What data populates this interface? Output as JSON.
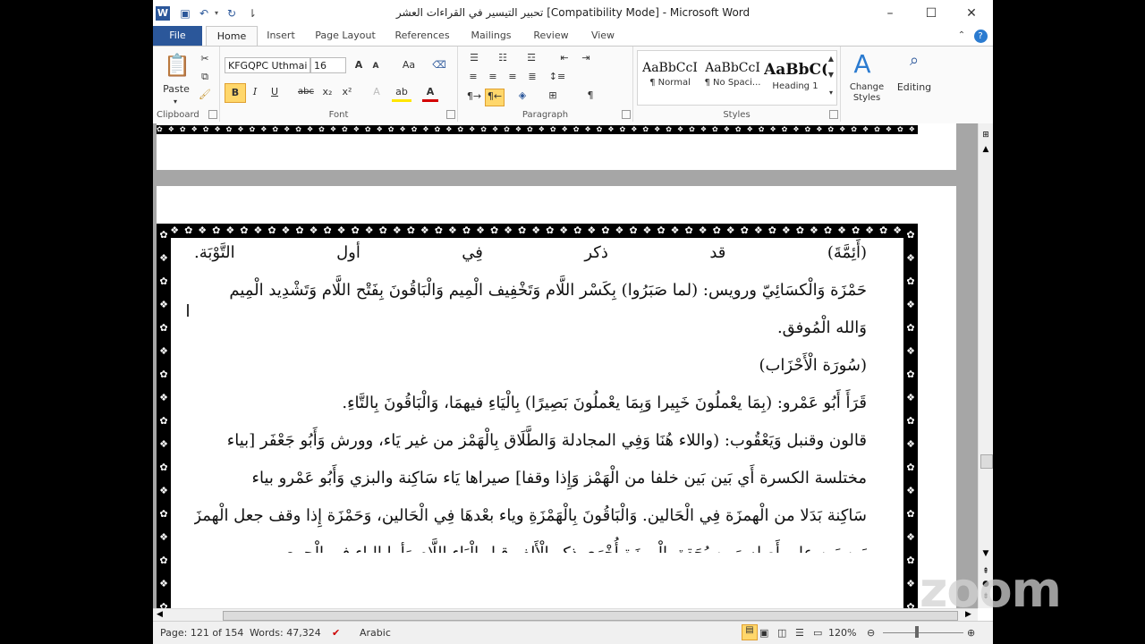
{
  "window": {
    "title": "تحبير التيسير في القراءات العشر [Compatibility Mode]  -  Microsoft Word",
    "minimize": "–",
    "maximize": "☐",
    "close": "✕"
  },
  "tabs": [
    {
      "label": "File"
    },
    {
      "label": "Home"
    },
    {
      "label": "Insert"
    },
    {
      "label": "Page Layout"
    },
    {
      "label": "References"
    },
    {
      "label": "Mailings"
    },
    {
      "label": "Review"
    },
    {
      "label": "View"
    }
  ],
  "ribbon": {
    "clipboard": {
      "paste": "Paste",
      "label": "Clipboard"
    },
    "font": {
      "name": "KFGQPC Uthmai",
      "size": "16",
      "label": "Font",
      "bold": "B",
      "italic": "I",
      "underline": "U",
      "strike": "abc",
      "subscript": "x₂",
      "superscript": "x²",
      "grow": "A",
      "shrink": "A",
      "case": "Aa"
    },
    "paragraph": {
      "label": "Paragraph"
    },
    "styles": {
      "label": "Styles",
      "items": [
        {
          "sample": "AaBbCcI",
          "name": "¶ Normal"
        },
        {
          "sample": "AaBbCcI",
          "name": "¶ No Spaci..."
        },
        {
          "sample": "AaBbC(",
          "name": "Heading 1"
        }
      ],
      "change_styles": "Change Styles"
    },
    "editing": {
      "label": "Editing"
    }
  },
  "document": {
    "lines": [
      "(أَئِمَّةَ)     قد      ذكر      فِي      أول      التَّوْبَة.",
      "حَمْزَة وَالْكسَائِيّ ورويس: (لما صَبَرُوا) بِكَسْر اللَّام وَتَخْفِيف الْمِيم وَالْبَاقُونَ بِفَتْح اللَّام وَتَشْدِيد الْمِيم",
      "وَالله الْمُوفق.",
      "(سُورَة الْأَحْزَاب)",
      "قَرَأَ أَبُو عَمْرو: (بِمَا يعْملُونَ خَبِيرا وَبِمَا يعْملُونَ بَصِيرًا) بِالْيَاءِ فيهمَا، وَالْبَاقُونَ بِالتَّاءِ.",
      "قالون وقنبل وَيَعْقُوب: (واللاء هُنَا وَفِي المجادلة وَالطَّلَاق بِالْهَمْز من غير يَاء، وورش وَأَبُو جَعْفَر [بياء",
      "مختلسة الكسرة أَي بَين بَين خلفا من الْهَمْز وَإِذا وقفا] صيراها يَاء سَاكِنة والبزي وَأَبُو عَمْرو بياء",
      "سَاكِنة بَدَلا من الْهمزَة فِي الْحَالين. وَالْبَاقُونَ بِالْهَمْزَةِ وياء بعْدهَا فِي الْحَالين، وَحَمْزَة إِذا وقف جعل الْهمزَة",
      "بَين بَين على أَصله وَمن يُحَقق الْهمزَة أُخْرَى ذكر الْأَلِف قبل الْيَاء اللَّام وَأما الياء فِي الْجمع"
    ]
  },
  "statusbar": {
    "page": "Page: 121 of 154",
    "words": "Words: 47,324",
    "language": "Arabic",
    "zoom": "120%"
  },
  "watermark": "zoom"
}
